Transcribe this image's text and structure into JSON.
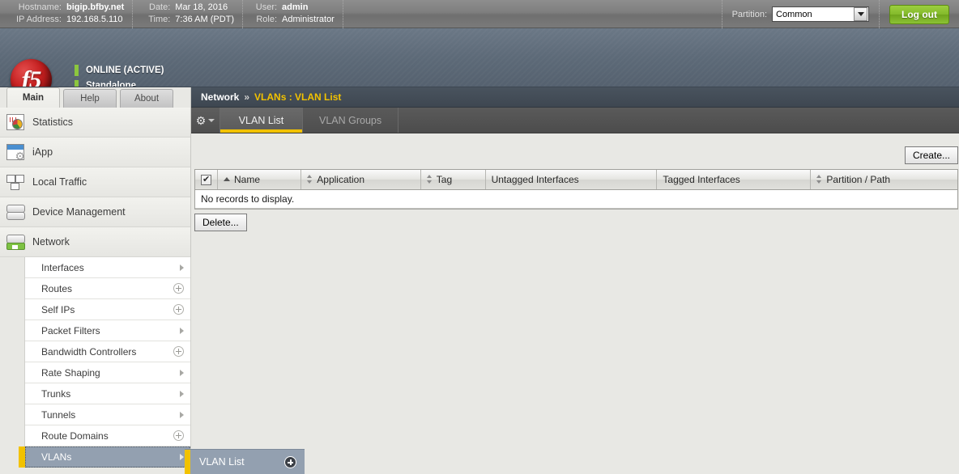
{
  "topbar": {
    "groups": [
      {
        "rows": [
          {
            "label": "Hostname:",
            "value": "bigip.bfby.net",
            "bold": true
          },
          {
            "label": "IP Address:",
            "value": "192.168.5.110",
            "bold": false
          }
        ]
      },
      {
        "rows": [
          {
            "label": "Date:",
            "value": "Mar 18, 2016",
            "bold": false
          },
          {
            "label": "Time:",
            "value": "7:36 AM (PDT)",
            "bold": false
          }
        ]
      },
      {
        "rows": [
          {
            "label": "User:",
            "value": "admin",
            "bold": true
          },
          {
            "label": "Role:",
            "value": "Administrator",
            "bold": false
          }
        ]
      }
    ],
    "partition_label": "Partition:",
    "partition_value": "Common",
    "partition_options": [
      "Common"
    ],
    "logout_label": "Log out"
  },
  "brand": {
    "logo_text": "f5",
    "status_primary": "ONLINE (ACTIVE)",
    "status_secondary": "Standalone",
    "status_color": "#8cc63e"
  },
  "main_tabs": [
    {
      "label": "Main",
      "active": true
    },
    {
      "label": "Help",
      "active": false
    },
    {
      "label": "About",
      "active": false
    }
  ],
  "sidebar": {
    "items": [
      {
        "label": "Statistics",
        "icon": "statistics-icon"
      },
      {
        "label": "iApp",
        "icon": "iapp-icon"
      },
      {
        "label": "Local Traffic",
        "icon": "local-traffic-icon"
      },
      {
        "label": "Device Management",
        "icon": "device-management-icon"
      },
      {
        "label": "Network",
        "icon": "network-icon"
      }
    ],
    "submenu": [
      {
        "label": "Interfaces",
        "affordance": "chevron",
        "selected": false
      },
      {
        "label": "Routes",
        "affordance": "plus",
        "selected": false
      },
      {
        "label": "Self IPs",
        "affordance": "plus",
        "selected": false
      },
      {
        "label": "Packet Filters",
        "affordance": "chevron",
        "selected": false
      },
      {
        "label": "Bandwidth Controllers",
        "affordance": "plus",
        "selected": false
      },
      {
        "label": "Rate Shaping",
        "affordance": "chevron",
        "selected": false
      },
      {
        "label": "Trunks",
        "affordance": "chevron",
        "selected": false
      },
      {
        "label": "Tunnels",
        "affordance": "chevron",
        "selected": false
      },
      {
        "label": "Route Domains",
        "affordance": "plus",
        "selected": false
      },
      {
        "label": "VLANs",
        "affordance": "chevron",
        "selected": true
      }
    ],
    "flyout": [
      {
        "label": "VLAN List",
        "affordance": "plus-dark"
      }
    ],
    "accent_color": "#f2c200",
    "selected_bg": "#93a0b0"
  },
  "breadcrumb": {
    "root": "Network",
    "separator": "»",
    "current": "VLANs : VLAN List",
    "current_color": "#f2c200"
  },
  "subtabs": {
    "gear_icon": "gear-icon",
    "tabs": [
      {
        "label": "VLAN List",
        "active": true
      },
      {
        "label": "VLAN Groups",
        "active": false
      }
    ]
  },
  "toolbar": {
    "create_label": "Create...",
    "delete_label": "Delete..."
  },
  "table": {
    "select_all_checked": true,
    "columns": [
      {
        "label": "Name",
        "sort": "asc"
      },
      {
        "label": "Application",
        "sort": "both"
      },
      {
        "label": "Tag",
        "sort": "both"
      },
      {
        "label": "Untagged Interfaces",
        "sort": "none"
      },
      {
        "label": "Tagged Interfaces",
        "sort": "none"
      },
      {
        "label": "Partition / Path",
        "sort": "both"
      }
    ],
    "rows": [],
    "empty_message": "No records to display."
  }
}
